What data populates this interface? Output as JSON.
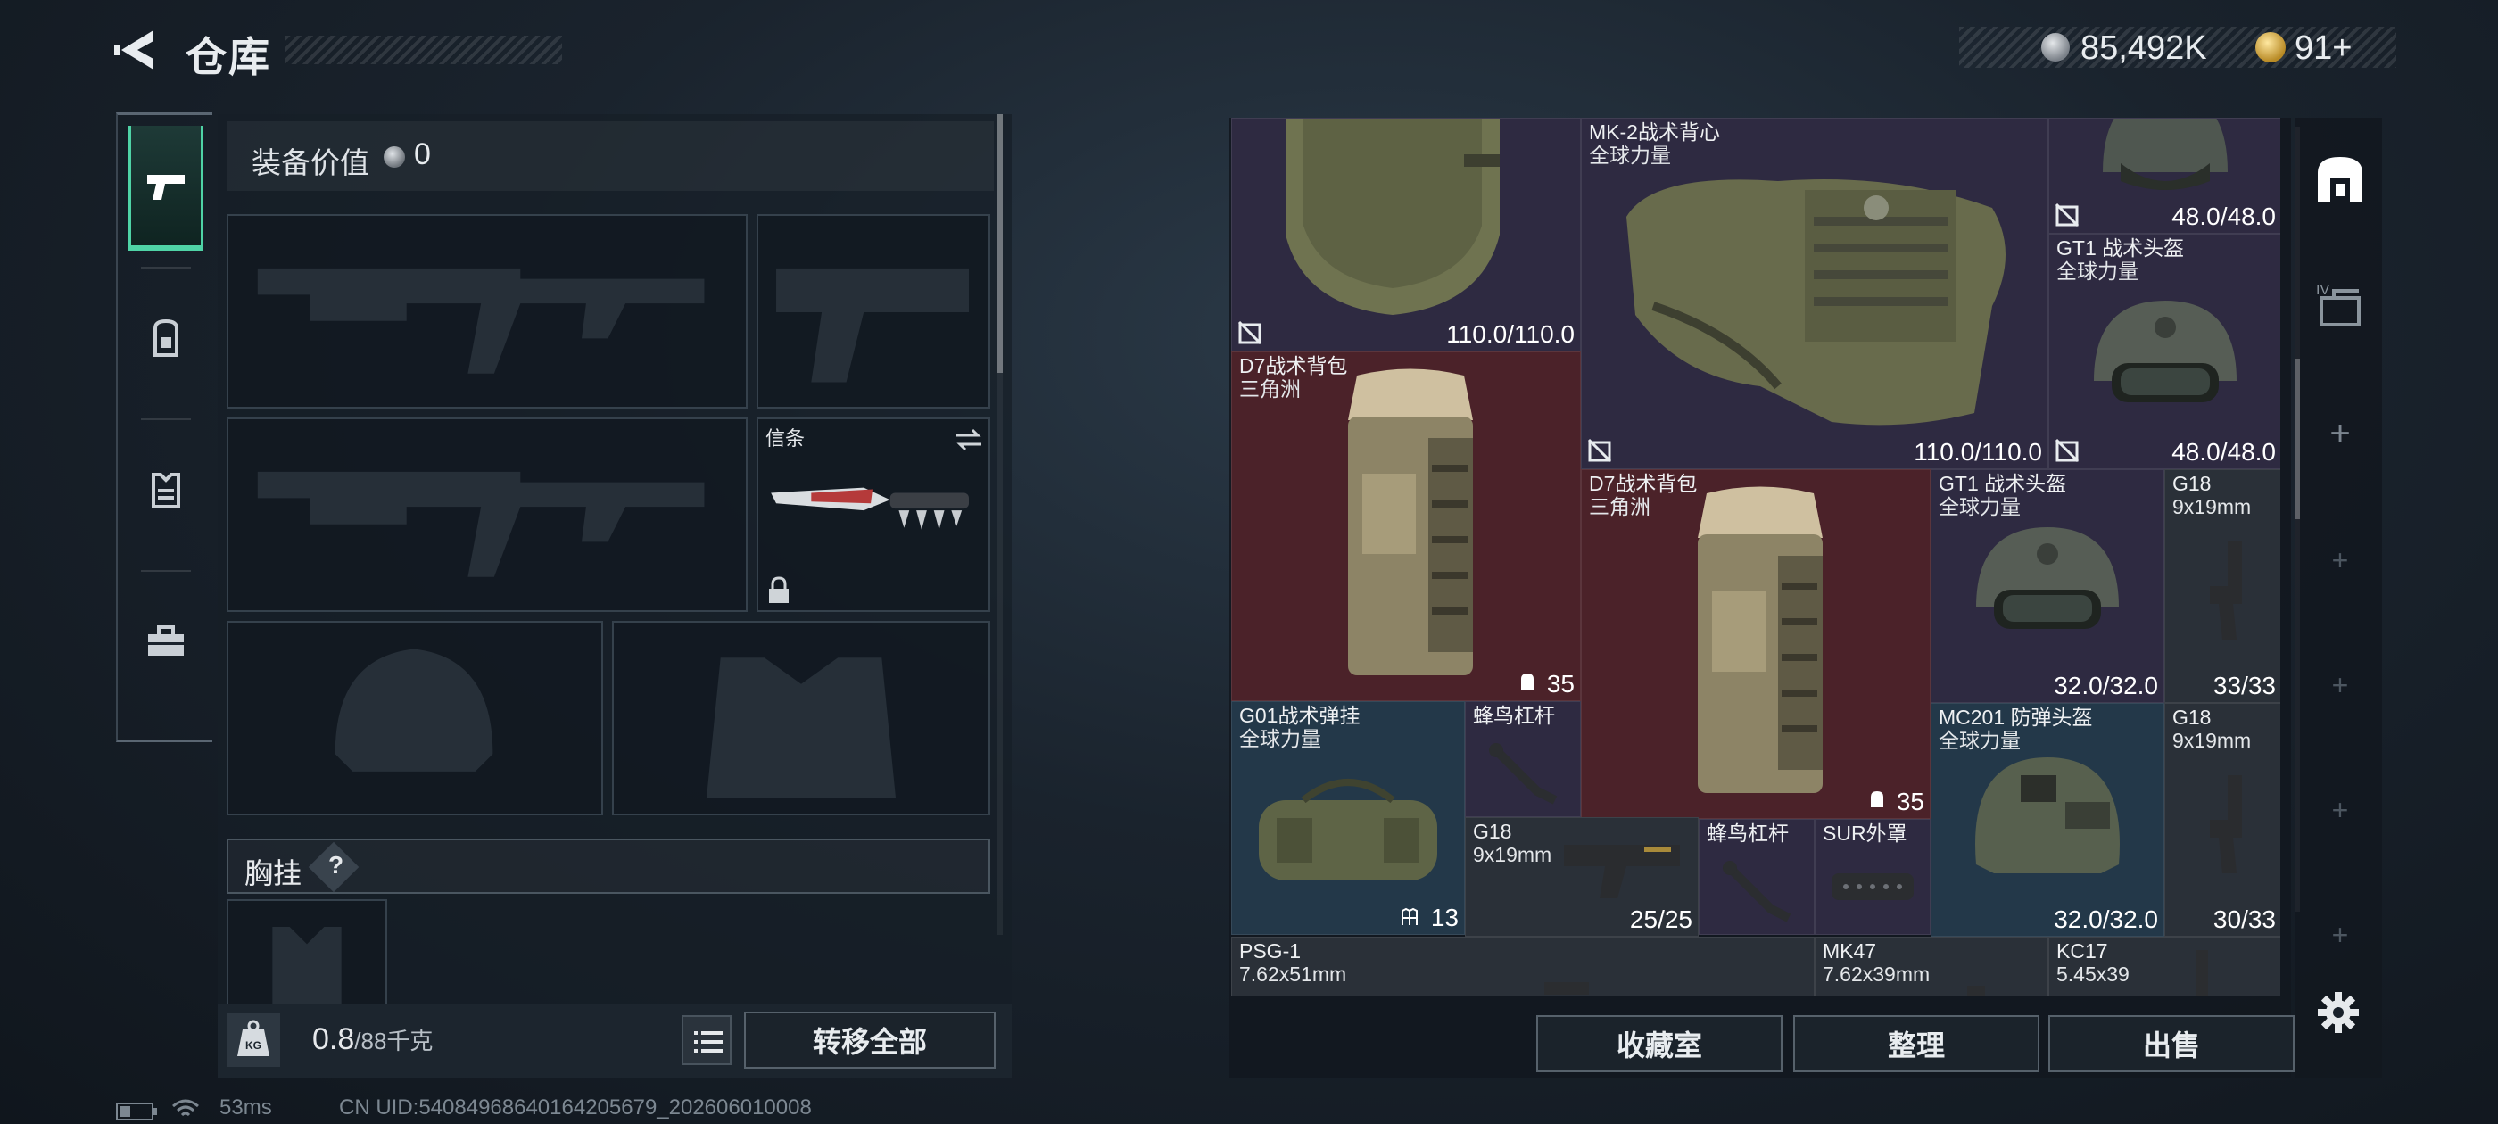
{
  "header": {
    "title": "仓库",
    "currency_primary": "85,492K",
    "currency_secondary": "91+"
  },
  "tabs": [
    {
      "name": "weapons",
      "active": true
    },
    {
      "name": "backpack",
      "active": false
    },
    {
      "name": "vest",
      "active": false
    },
    {
      "name": "toolbox",
      "active": false
    }
  ],
  "loadout": {
    "equip_value_label": "装备价值",
    "equip_value": "0",
    "knife_label": "信条",
    "chest_label": "胸挂",
    "chest_help": "?"
  },
  "weight": {
    "current": "0.8",
    "capacity": "/88千克",
    "icon_text": "KG"
  },
  "buttons": {
    "transfer_all": "转移全部",
    "collection": "收藏室",
    "sort": "整理",
    "sell": "出售"
  },
  "status": {
    "ping": "53ms",
    "uid": "CN UID:54084968640164205679_202606010008"
  },
  "stash": {
    "vest_top_left_value": "110.0/110.0",
    "mk2_name": "MK-2战术背心",
    "mk2_sub": "全球力量",
    "mk2_value": "110.0/110.0",
    "helmet_top_value": "48.0/48.0",
    "gt1_a_name": "GT1 战术头盔",
    "gt1_a_sub": "全球力量",
    "gt1_a_value": "48.0/48.0",
    "d7_a_name": "D7战术背包",
    "d7_a_sub": "三角洲",
    "d7_a_value": "35",
    "d7_b_name": "D7战术背包",
    "d7_b_sub": "三角洲",
    "d7_b_value": "35",
    "gt1_b_name": "GT1 战术头盔",
    "gt1_b_sub": "全球力量",
    "gt1_b_value": "32.0/32.0",
    "g18_a_name": "G18",
    "g18_a_sub": "9x19mm",
    "g18_a_value": "33/33",
    "g01_name": "G01战术弹挂",
    "g01_sub": "全球力量",
    "g01_value": "13",
    "lever_a_name": "蜂鸟杠杆",
    "mc201_name": "MC201 防弹头盔",
    "mc201_sub": "全球力量",
    "mc201_value": "32.0/32.0",
    "g18_b_name": "G18",
    "g18_b_sub": "9x19mm",
    "g18_b_value": "30/33",
    "g18_c_name": "G18",
    "g18_c_sub": "9x19mm",
    "g18_c_value": "25/25",
    "lever_b_name": "蜂鸟杠杆",
    "sur_name": "SUR外罩",
    "psg_name": "PSG-1",
    "psg_sub": "7.62x51mm",
    "mk47_name": "MK47",
    "mk47_sub": "7.62x39mm",
    "kc17_name": "KC17",
    "kc17_sub": "5.45x39"
  },
  "colors": {
    "accent_green": "#4fd3a6",
    "cell_purple": "#2e2a41",
    "cell_red": "#4b2229",
    "cell_blue": "#233849",
    "cell_grey": "#2a3038"
  }
}
